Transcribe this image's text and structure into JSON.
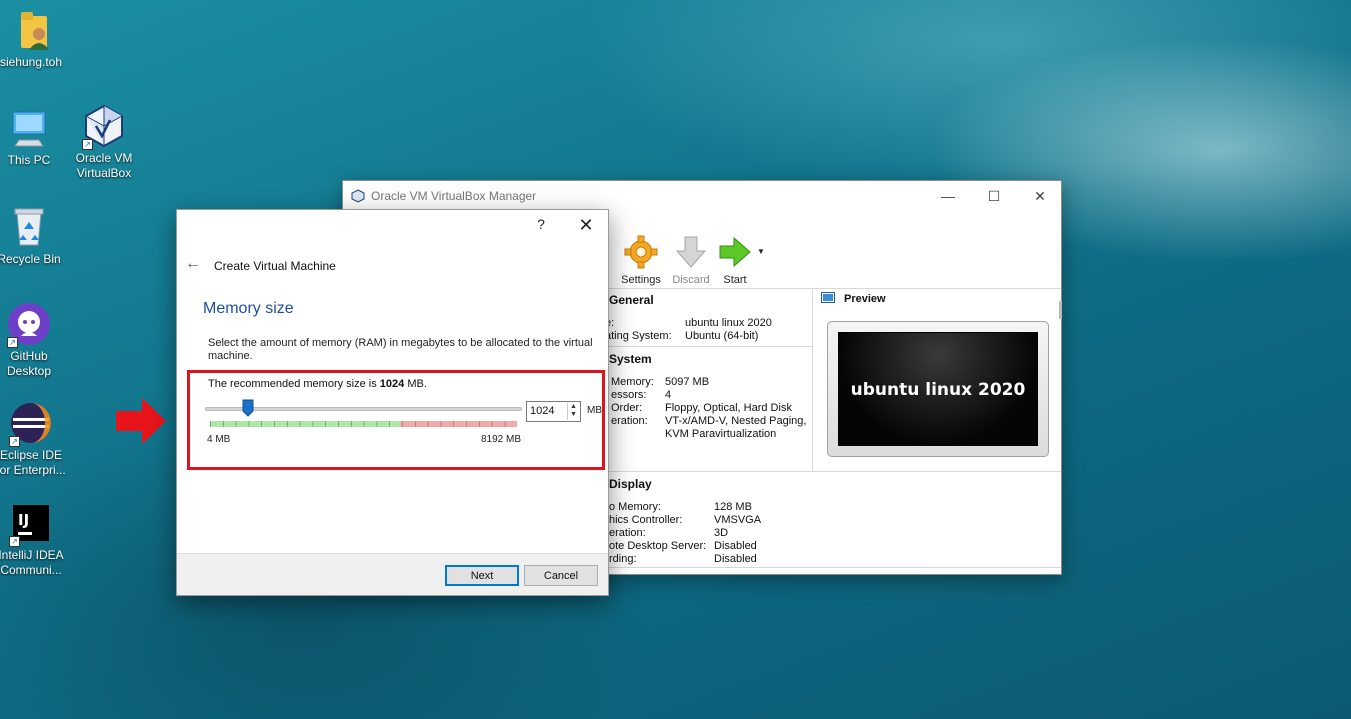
{
  "desktop": {
    "icons": [
      {
        "label": "siehung.toh"
      },
      {
        "label": "This PC"
      },
      {
        "label": "Oracle VM\nVirtualBox"
      },
      {
        "label": "Recycle Bin"
      },
      {
        "label": "GitHub\nDesktop"
      },
      {
        "label": "Eclipse IDE\nfor Enterpri..."
      },
      {
        "label": "IntelliJ IDEA\nCommuni..."
      }
    ]
  },
  "vbox": {
    "title": "Oracle VM VirtualBox Manager",
    "toolbar": {
      "settings": "Settings",
      "discard": "Discard",
      "start": "Start"
    },
    "general": {
      "heading": "General",
      "rows": [
        {
          "k": "e:",
          "v": "ubuntu linux 2020"
        },
        {
          "k": "ating System:",
          "v": "Ubuntu (64-bit)"
        }
      ]
    },
    "system": {
      "heading": "System",
      "rows": [
        {
          "k": "Memory:",
          "v": "5097 MB"
        },
        {
          "k": "essors:",
          "v": "4"
        },
        {
          "k": "Order:",
          "v": "Floppy, Optical, Hard Disk"
        },
        {
          "k": "eration:",
          "v": "VT-x/AMD-V, Nested Paging,"
        },
        {
          "k": "",
          "v": "KVM Paravirtualization"
        }
      ]
    },
    "preview": {
      "heading": "Preview",
      "screen_text": "ubuntu linux 2020"
    },
    "display": {
      "heading": "Display",
      "rows": [
        {
          "k": "o Memory:",
          "v": "128 MB"
        },
        {
          "k": "hics Controller:",
          "v": "VMSVGA"
        },
        {
          "k": "eration:",
          "v": "3D"
        },
        {
          "k": "ote Desktop Server:",
          "v": "Disabled"
        },
        {
          "k": "rding:",
          "v": "Disabled"
        }
      ]
    }
  },
  "dialog": {
    "help": "?",
    "close": "✕",
    "back": "←",
    "title": "Create Virtual Machine",
    "heading": "Memory size",
    "description": "Select the amount of memory (RAM) in megabytes to be allocated to the virtual machine.",
    "recommended_prefix": "The recommended memory size is ",
    "recommended_value": "1024",
    "recommended_suffix": " MB.",
    "memory": {
      "value": 1024,
      "value_text": "1024",
      "min": 4,
      "max": 8192,
      "min_label": "4 MB",
      "max_label": "8192 MB",
      "unit": "MB",
      "safe_fraction": 0.62
    },
    "buttons": {
      "next": "Next",
      "cancel": "Cancel"
    }
  },
  "colors": {
    "highlight": "#e0141e",
    "heading_blue": "#1f4e9e",
    "slider_safe": "#aee8a6",
    "slider_danger": "#f2aaaa"
  }
}
